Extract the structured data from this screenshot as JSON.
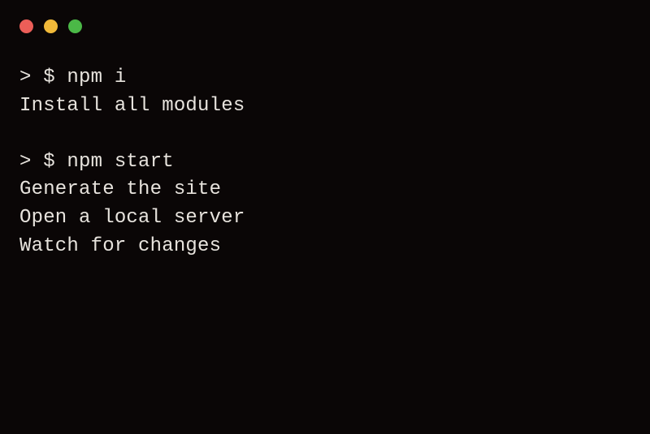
{
  "window": {
    "buttons": {
      "close": "close",
      "minimize": "minimize",
      "maximize": "maximize"
    }
  },
  "terminal": {
    "prompt": "> $ ",
    "blocks": [
      {
        "command": "npm i",
        "output": [
          "Install all modules"
        ]
      },
      {
        "command": "npm start",
        "output": [
          "Generate the site",
          "Open a local server",
          "Watch for changes"
        ]
      }
    ]
  }
}
